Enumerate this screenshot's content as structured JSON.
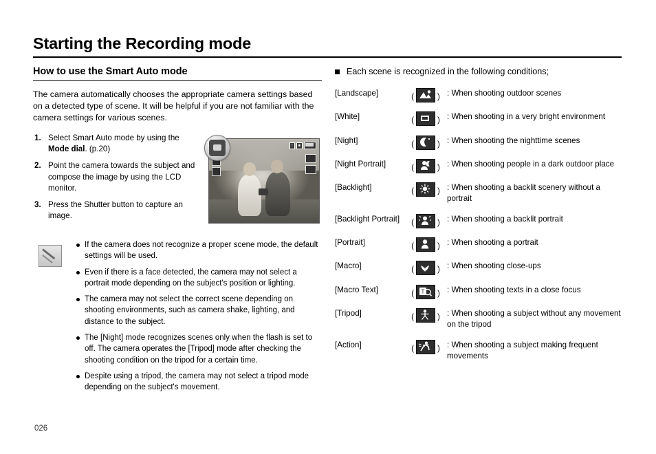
{
  "page": {
    "title": "Starting the Recording mode",
    "number": "026"
  },
  "left": {
    "section_heading": "How to use the Smart Auto mode",
    "intro": "The camera automatically chooses the appropriate camera settings based on a detected type of scene. It will be helpful if you are not familiar with the camera settings for various scenes.",
    "steps": [
      {
        "num": "1.",
        "text_before": "Select Smart Auto mode by using the ",
        "bold": "Mode dial",
        "text_after": ". (p.20)"
      },
      {
        "num": "2.",
        "text_before": "Point the camera towards the subject and compose the image by using the LCD monitor.",
        "bold": "",
        "text_after": ""
      },
      {
        "num": "3.",
        "text_before": "Press the Shutter button to capture an image.",
        "bold": "",
        "text_after": ""
      }
    ],
    "notes": [
      "If the camera does not recognize a proper scene mode, the default settings will be used.",
      "Even if there is a face detected, the camera may not select a portrait mode depending on the subject's position or lighting.",
      "The camera may not select the correct scene depending on shooting environments, such as camera shake, lighting, and distance to the subject.",
      "The [Night] mode recognizes scenes only when the flash is set to off. The camera operates the [Tripod] mode after checking the shooting condition on the tripod for a certain time.",
      "Despite using a tripod, the camera may not select a tripod mode depending on the subject's movement."
    ]
  },
  "right": {
    "heading": "Each scene is recognized in the following conditions;",
    "open_paren": "(",
    "close_paren": ")",
    "colon": ":",
    "scenes": [
      {
        "name": "[Landscape]",
        "icon": "landscape-icon",
        "desc": "When shooting outdoor scenes"
      },
      {
        "name": "[White]",
        "icon": "white-icon",
        "desc": "When shooting in a very bright environment"
      },
      {
        "name": "[Night]",
        "icon": "night-icon",
        "desc": "When shooting the nighttime scenes"
      },
      {
        "name": "[Night Portrait]",
        "icon": "night-portrait-icon",
        "desc": "When shooting people in a dark outdoor place"
      },
      {
        "name": "[Backlight]",
        "icon": "backlight-icon",
        "desc": "When shooting a backlit scenery without a portrait"
      },
      {
        "name": "[Backlight Portrait]",
        "icon": "backlight-portrait-icon",
        "desc": "When shooting a backlit portrait"
      },
      {
        "name": "[Portrait]",
        "icon": "portrait-icon",
        "desc": "When shooting a portrait"
      },
      {
        "name": "[Macro]",
        "icon": "macro-icon",
        "desc": "When shooting close-ups"
      },
      {
        "name": "[Macro Text]",
        "icon": "macro-text-icon",
        "desc": "When shooting texts in a close focus"
      },
      {
        "name": "[Tripod]",
        "icon": "tripod-icon",
        "desc": "When shooting a subject without any movement on the tripod"
      },
      {
        "name": "[Action]",
        "icon": "action-icon",
        "desc": "When shooting a subject making frequent movements"
      }
    ]
  },
  "colors": {
    "text": "#000000",
    "icon_background": "#2e2e2e",
    "icon_foreground": "#ffffff"
  }
}
